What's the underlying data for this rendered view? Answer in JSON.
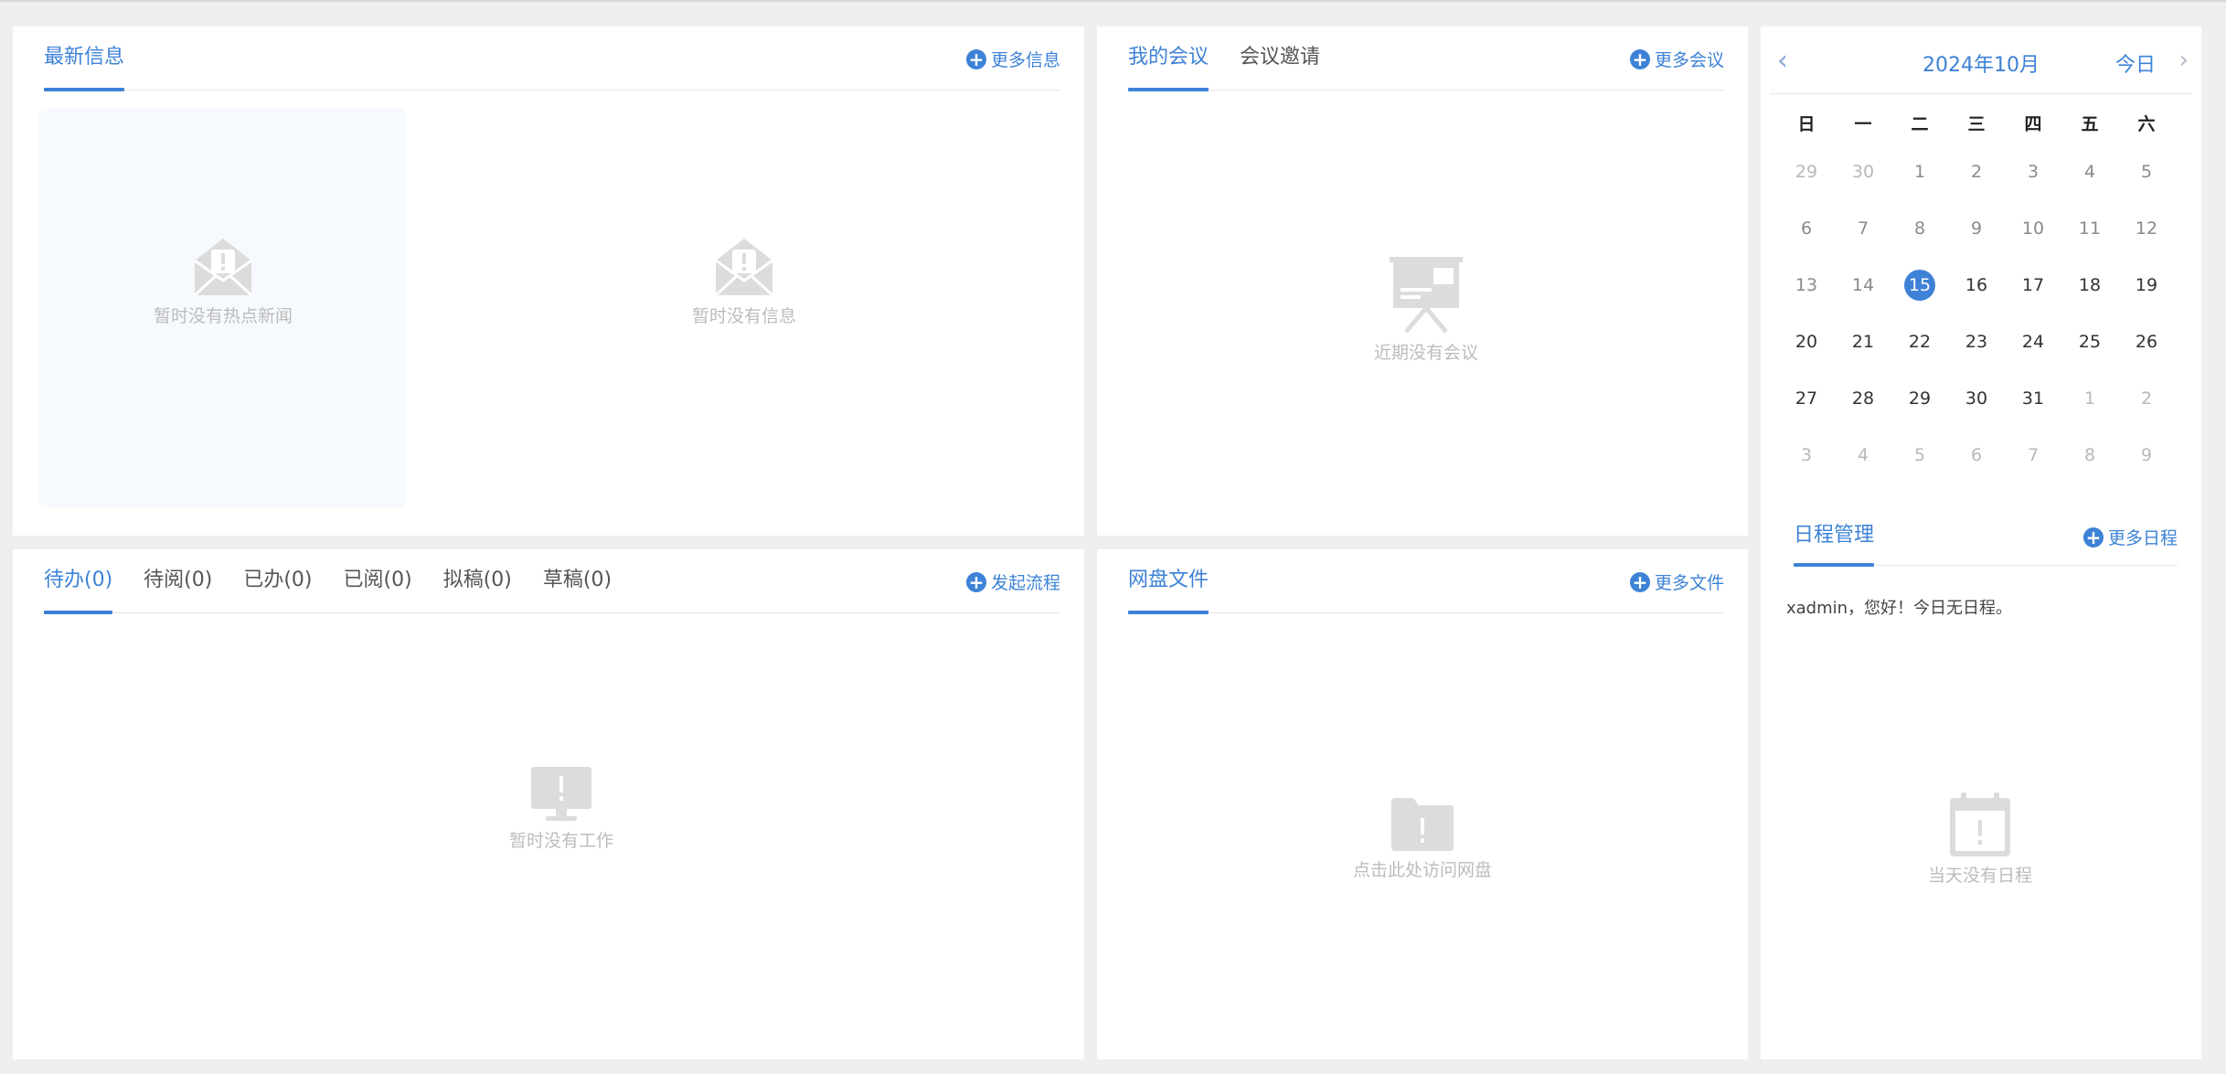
{
  "news": {
    "tab": "最新信息",
    "more": "更多信息",
    "hot_empty": "暂时没有热点新闻",
    "info_empty": "暂时没有信息"
  },
  "meeting": {
    "tabs": [
      "我的会议",
      "会议邀请"
    ],
    "more": "更多会议",
    "empty": "近期没有会议"
  },
  "todo": {
    "tabs": [
      "待办(0)",
      "待阅(0)",
      "已办(0)",
      "已阅(0)",
      "拟稿(0)",
      "草稿(0)"
    ],
    "more": "发起流程",
    "empty": "暂时没有工作"
  },
  "disk": {
    "tab": "网盘文件",
    "more": "更多文件",
    "empty": "点击此处访问网盘"
  },
  "calendar": {
    "prev": "‹",
    "next": "›",
    "title": "2024年10月",
    "today_btn": "今日",
    "weekdays": [
      "日",
      "一",
      "二",
      "三",
      "四",
      "五",
      "六"
    ],
    "weeks": [
      [
        "29",
        "30",
        "1",
        "2",
        "3",
        "4",
        "5"
      ],
      [
        "6",
        "7",
        "8",
        "9",
        "10",
        "11",
        "12"
      ],
      [
        "13",
        "14",
        "15",
        "16",
        "17",
        "18",
        "19"
      ],
      [
        "20",
        "21",
        "22",
        "23",
        "24",
        "25",
        "26"
      ],
      [
        "27",
        "28",
        "29",
        "30",
        "31",
        "1",
        "2"
      ],
      [
        "3",
        "4",
        "5",
        "6",
        "7",
        "8",
        "9"
      ]
    ],
    "today": "15"
  },
  "schedule": {
    "tab": "日程管理",
    "more": "更多日程",
    "greeting": "xadmin，您好！今日无日程。",
    "empty": "当天没有日程"
  },
  "colors": {
    "accent": "#3d82d6",
    "empty_text": "#bcbcbc",
    "icon_gray": "#dcdcdc",
    "page_bg": "#efefef"
  },
  "icons": {
    "plus": "plus-circle-icon",
    "mail": "envelope-alert-icon",
    "board": "presentation-board-icon",
    "monitor": "monitor-alert-icon",
    "folder": "folder-alert-icon",
    "calendar": "calendar-alert-icon"
  }
}
